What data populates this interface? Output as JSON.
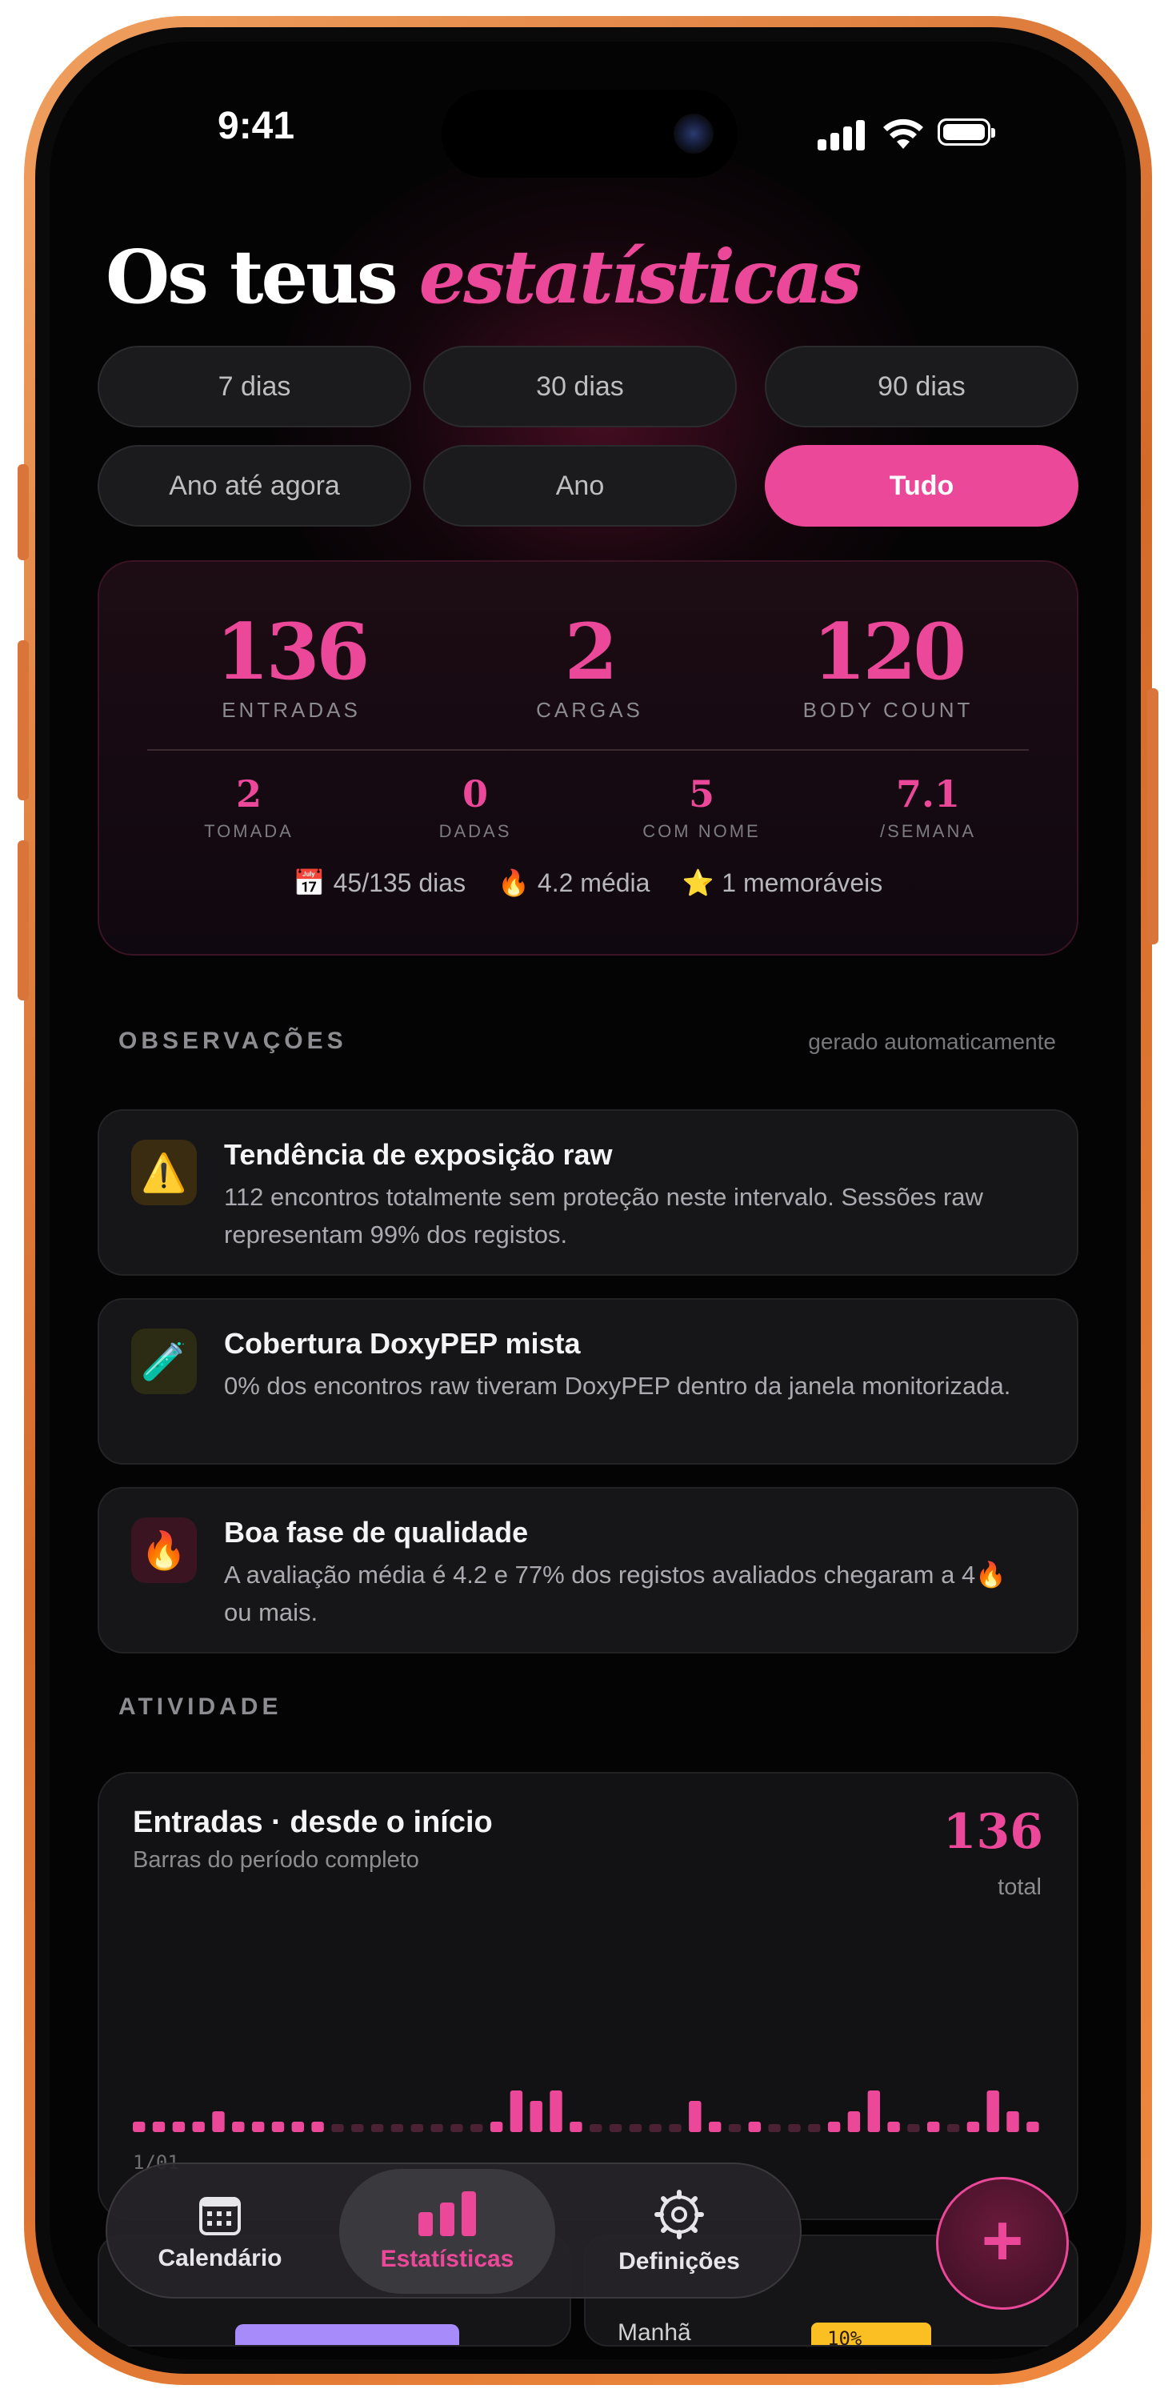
{
  "status_bar": {
    "time": "9:41"
  },
  "header": {
    "title_plain": "Os teus",
    "title_accent": "estatísticas"
  },
  "filters": [
    {
      "label": "7 dias",
      "active": false
    },
    {
      "label": "30 dias",
      "active": false
    },
    {
      "label": "90 dias",
      "active": false
    },
    {
      "label": "Ano até agora",
      "active": false
    },
    {
      "label": "Ano",
      "active": false
    },
    {
      "label": "Tudo",
      "active": true
    }
  ],
  "summary": {
    "primary": [
      {
        "value": "136",
        "label": "ENTRADAS"
      },
      {
        "value": "2",
        "label": "CARGAS"
      },
      {
        "value": "120",
        "label": "BODY COUNT"
      }
    ],
    "secondary": [
      {
        "value": "2",
        "label": "TOMADA"
      },
      {
        "value": "0",
        "label": "DADAS"
      },
      {
        "value": "5",
        "label": "COM NOME"
      },
      {
        "value": "7.1",
        "label": "/SEMANA"
      }
    ],
    "meta": [
      {
        "icon": "calendar-icon",
        "glyph": "📅",
        "text": "45/135 dias"
      },
      {
        "icon": "fire-icon",
        "glyph": "🔥",
        "text": "4.2 média"
      },
      {
        "icon": "star-icon",
        "glyph": "⭐",
        "text": "1 memoráveis"
      }
    ]
  },
  "observations": {
    "heading": "OBSERVAÇÕES",
    "note": "gerado automaticamente",
    "items": [
      {
        "icon": "warning-icon",
        "glyph": "⚠️",
        "icon_bg": "#3a2c10",
        "title": "Tendência de exposição raw",
        "body": "112 encontros totalmente sem proteção neste intervalo. Sessões raw representam 99% dos registos."
      },
      {
        "icon": "test-tube-icon",
        "glyph": "🧪",
        "icon_bg": "#2c2c14",
        "title": "Cobertura DoxyPEP mista",
        "body": "0% dos encontros raw tiveram DoxyPEP dentro da janela monitorizada."
      },
      {
        "icon": "fire-icon",
        "glyph": "🔥",
        "icon_bg": "#3a1420",
        "title": "Boa fase de qualidade",
        "body": "A avaliação média é 4.2 e 77% dos registos avaliados chegaram a 4🔥 ou mais."
      }
    ]
  },
  "activity": {
    "heading": "ATIVIDADE",
    "card_title": "Entradas · desde o início",
    "card_subtitle": "Barras do período completo",
    "total_value": "136",
    "total_label": "total",
    "axis_start": "1/01",
    "peek_left_label": "",
    "peek_right_label": "Manhã",
    "peek_right_pct": "10%"
  },
  "chart_data": {
    "type": "bar",
    "title": "Entradas · desde o início",
    "subtitle": "Barras do período completo",
    "x_start_label": "1/01",
    "values": [
      1,
      1,
      1,
      1,
      2,
      1,
      1,
      1,
      1,
      1,
      0,
      0,
      0,
      0,
      0,
      0,
      0,
      0,
      1,
      4,
      3,
      4,
      1,
      0,
      0,
      0,
      0,
      0,
      3,
      1,
      0,
      1,
      0,
      0,
      0,
      1,
      2,
      4,
      1,
      0,
      1,
      0,
      1,
      4,
      2,
      1
    ],
    "colors": {
      "active": "#ec4899",
      "empty": "#4a2233"
    }
  },
  "tabbar": {
    "items": [
      {
        "label": "Calendário",
        "icon": "calendar-icon",
        "active": false
      },
      {
        "label": "Estatísticas",
        "icon": "bar-chart-icon",
        "active": true
      },
      {
        "label": "Definições",
        "icon": "gear-icon",
        "active": false
      }
    ],
    "fab_symbol": "+"
  },
  "theme": {
    "accent": "#ec4899",
    "background": "#050405",
    "card": "#161618",
    "frame": "#e07a35"
  }
}
